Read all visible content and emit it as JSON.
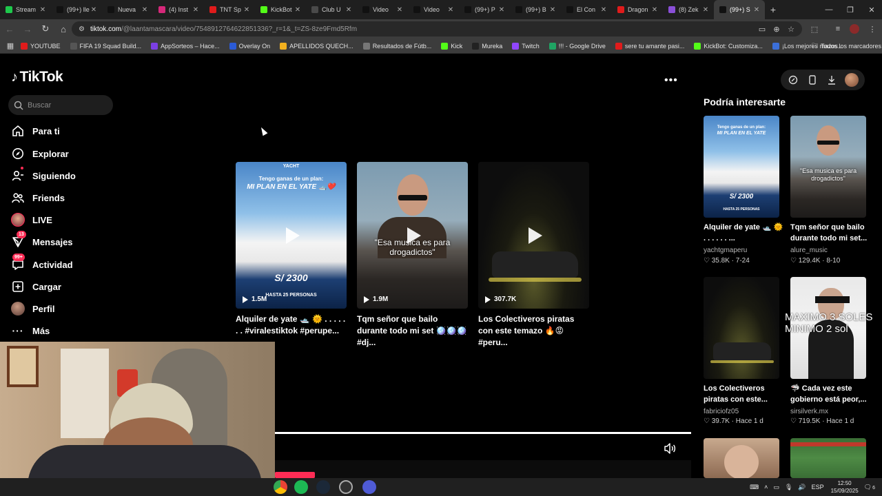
{
  "browser": {
    "tabs": [
      {
        "label": "Stream",
        "color": "#1ec94c"
      },
      {
        "label": "(99+) lle",
        "color": "#111111"
      },
      {
        "label": "Nueva",
        "color": "#111111"
      },
      {
        "label": "(4) Inst",
        "color": "#d6287a"
      },
      {
        "label": "TNT Sp",
        "color": "#e01b1b"
      },
      {
        "label": "KickBot",
        "color": "#53fc18"
      },
      {
        "label": "Club U",
        "color": "#4a4a4a"
      },
      {
        "label": "Video",
        "color": "#111111"
      },
      {
        "label": "Video",
        "color": "#111111"
      },
      {
        "label": "(99+) P",
        "color": "#111111"
      },
      {
        "label": "(99+) B",
        "color": "#111111"
      },
      {
        "label": "El Con",
        "color": "#111111"
      },
      {
        "label": "Dragon",
        "color": "#e01b1b"
      },
      {
        "label": "(8) Zek",
        "color": "#8a4fd8"
      },
      {
        "label": "(99+) S",
        "color": "#111111"
      }
    ],
    "url_host": "tiktok.com",
    "url_path": "/@laantamascara/video/7548912764622851336?_r=1&_t=ZS-8ze9Fmd5Rfm",
    "bookmarks": [
      {
        "label": "YOUTUBE",
        "color": "#e01b1b"
      },
      {
        "label": "FIFA 19 Squad Build...",
        "color": "#555555"
      },
      {
        "label": "AppSorteos – Hace...",
        "color": "#7b3fe4"
      },
      {
        "label": "Overlay On",
        "color": "#2b5bd7"
      },
      {
        "label": "APELLIDOS QUECH...",
        "color": "#f2b01e"
      },
      {
        "label": "Resultados de Fútb...",
        "color": "#777777"
      },
      {
        "label": "Kick",
        "color": "#53fc18"
      },
      {
        "label": "Mureka",
        "color": "#222222"
      },
      {
        "label": "Twitch",
        "color": "#9146ff"
      },
      {
        "label": "!!! - Google Drive",
        "color": "#1fa463"
      },
      {
        "label": "sere tu amante pasi...",
        "color": "#e01b1b"
      },
      {
        "label": "KickBot: Customiza...",
        "color": "#53fc18"
      },
      {
        "label": "¡Los mejores mazos...",
        "color": "#3b6fd8"
      }
    ],
    "all_bookmarks": "Todos los marcadores"
  },
  "tiktok": {
    "logo": "TikTok",
    "search_placeholder": "Buscar",
    "nav": [
      {
        "label": "Para ti",
        "icon": "home-icon",
        "badge": ""
      },
      {
        "label": "Explorar",
        "icon": "compass-icon",
        "badge": ""
      },
      {
        "label": "Siguiendo",
        "icon": "following-icon",
        "badge": ""
      },
      {
        "label": "Friends",
        "icon": "friends-icon",
        "badge": ""
      },
      {
        "label": "LIVE",
        "icon": "live-icon",
        "badge": ""
      },
      {
        "label": "Mensajes",
        "icon": "messages-icon",
        "badge": "13"
      },
      {
        "label": "Actividad",
        "icon": "activity-icon",
        "badge": "99+"
      },
      {
        "label": "Cargar",
        "icon": "upload-icon",
        "badge": ""
      },
      {
        "label": "Perfil",
        "icon": "profile-icon",
        "badge": ""
      },
      {
        "label": "Más",
        "icon": "more-icon",
        "badge": ""
      }
    ],
    "videos": [
      {
        "title": "Alquiler de yate 🛥️ 🌞 . . . . . . . #viralestiktok #perupe...",
        "views": "1.5M",
        "overlay_top": "Tengo ganas de un plan:",
        "overlay_main": "MI PLAN EN EL YATE 🛥️❤️",
        "overlay_price": "S/ 2300",
        "overlay_bottom": "HASTA 25 PERSONAS"
      },
      {
        "title": "Tqm señor que bailo durante todo mi set 🪩🪩🪩 #dj...",
        "views": "1.9M",
        "overlay_main": "\"Esa musica es para drogadictos\""
      },
      {
        "title": "Los Colectiveros piratas con este temazo 🔥😡 #peru...",
        "views": "307.7K"
      }
    ],
    "recommended_title": "Podría interesarte",
    "recommended": [
      {
        "title": "Alquiler de yate 🛥️ 🌞 . . . . . . ...",
        "author": "yachtgmaperu",
        "likes": "35.8K",
        "date": "7-24",
        "overlay_top": "Tengo ganas de un plan:",
        "overlay_main": "MI PLAN EN EL YATE",
        "overlay_price": "S/ 2300",
        "overlay_bottom": "HASTA 25 PERSONAS"
      },
      {
        "title": "Tqm señor que bailo durante todo mi set...",
        "author": "alure_music",
        "likes": "129.4K",
        "date": "8-10",
        "overlay_main": "\"Esa musica es para drogadictos\""
      },
      {
        "title": "Los Colectiveros piratas con este...",
        "author": "fabriciofz05",
        "likes": "39.7K",
        "date": "Hace 1 d"
      },
      {
        "title": "🦈 Cada vez este gobierno está peor,...",
        "author": "sirsilverk.mx",
        "likes": "719.5K",
        "date": "Hace 1 d",
        "overlay_main": "MAXIMO 3 SOLES MINIMO 2 sol"
      }
    ]
  },
  "taskbar": {
    "lang": "ESP",
    "time": "12:50",
    "date": "15/09/2025",
    "notif": "6"
  }
}
